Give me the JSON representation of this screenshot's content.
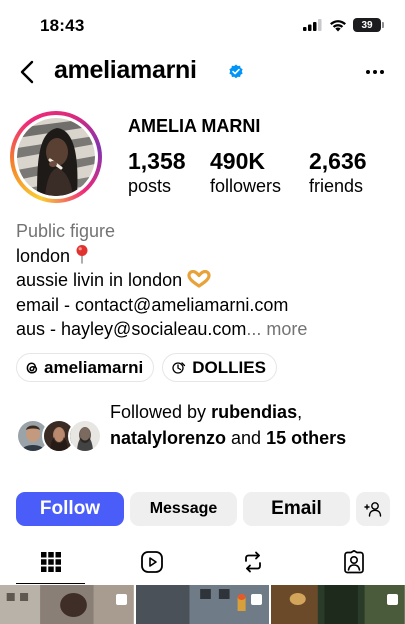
{
  "status_bar": {
    "time": "18:43",
    "battery": "39"
  },
  "header": {
    "username": "ameliamarni"
  },
  "profile": {
    "display_name": "AMELIA MARNI",
    "stats": [
      {
        "value": "1,358",
        "label": "posts"
      },
      {
        "value": "490K",
        "label": "followers"
      },
      {
        "value": "2,636",
        "label": "friends"
      }
    ],
    "bio": {
      "category": "Public figure",
      "lines": [
        "london",
        "aussie livin in london",
        "email - contact@ameliamarni.com",
        "aus - hayley@socialeau.com"
      ],
      "ellipsis": "...",
      "more": " more"
    },
    "chips": [
      {
        "label": "ameliamarni",
        "icon": "threads-icon"
      },
      {
        "label": "DOLLIES",
        "icon": "highlight-link-icon"
      }
    ],
    "followed_by": {
      "prefix": "Followed by ",
      "user1": "rubendias",
      "comma": ",",
      "user2": "natalylorenzo",
      "and": " and ",
      "others": "15 others"
    }
  },
  "actions": {
    "follow": "Follow",
    "message": "Message",
    "email": "Email"
  },
  "tabs": [
    {
      "name": "grid-icon",
      "active": true
    },
    {
      "name": "reels-icon",
      "active": false
    },
    {
      "name": "reposts-icon",
      "active": false
    },
    {
      "name": "tagged-icon",
      "active": false
    }
  ],
  "colors": {
    "follow_blue": "#4a5df9",
    "verified_blue": "#0095f6",
    "muted": "#737373"
  }
}
